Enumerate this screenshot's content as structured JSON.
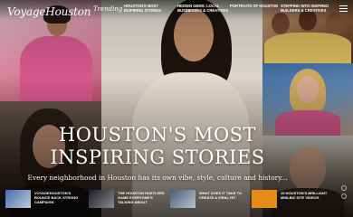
{
  "site": {
    "logo": "VoyageHouston",
    "logo_tag": "Trending"
  },
  "nav": [
    {
      "label": "Houston's Most Inspiring Stories"
    },
    {
      "label": "Hidden Gems: Local Businesses & Creatives"
    },
    {
      "label": "Portraits of Houston"
    },
    {
      "label": "Stepping Into Inspired Builders & Creatives"
    }
  ],
  "hero": {
    "headline": "HOUSTON'S MOST INSPIRING STORIES",
    "subheadline": "Every neighborhood in Houston has its own vibe, style, culture and history..."
  },
  "stories": [
    {
      "title": "VoyageHouston's Bounce Back Strong Campaign"
    },
    {
      "title": "The Houston Hustlers Game Everyone's Talking About"
    },
    {
      "title": "What does it take to create a viral hit"
    },
    {
      "title": "10 Houston's Brilliant Mini-Biz Site Videos"
    }
  ],
  "colors": {
    "accent_orange": "#e88a1a",
    "overlay": "#000000"
  },
  "icons": [
    "menu-icon"
  ]
}
